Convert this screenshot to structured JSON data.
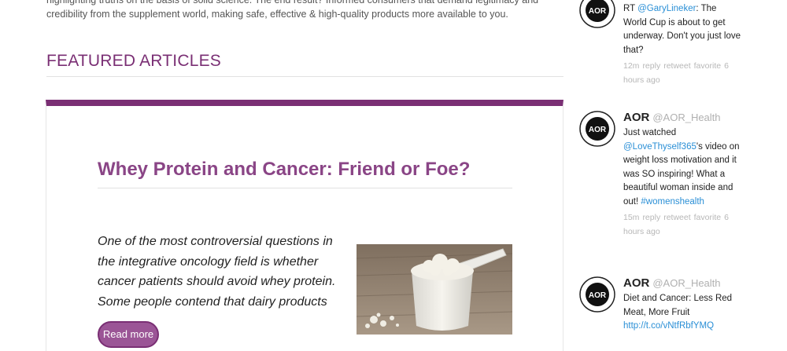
{
  "intro": {
    "line1": "highlighting truths on the basis of solid science. The end result? Informed consumers that demand legitimacy and",
    "line2": "credibility from the supplement world, making safe, effective & high-quality products more available to you."
  },
  "featured": {
    "title": "FEATURED ARTICLES",
    "article": {
      "title": "Whey Protein and Cancer: Friend or Foe?",
      "excerpt": "One of the most controversial questions in the integrative oncology field is whether cancer patients should avoid whey protein. Some people contend that dairy products",
      "read_more": "Read more",
      "image_alt": "scoop of whey protein powder"
    }
  },
  "tweets": [
    {
      "name": "",
      "handle": "",
      "text_prefix": "RT ",
      "mention": "@GaryLineker",
      "text_suffix": ": The World Cup is about to get underway. Don't you just love that?",
      "time": "12m",
      "reply": "reply",
      "retweet": "retweet",
      "favorite": "favorite",
      "ago": "6 hours ago"
    },
    {
      "name": "AOR",
      "handle": "@AOR_Health",
      "text_prefix": "Just watched ",
      "mention": "@LoveThyself365",
      "text_suffix": "'s video on weight loss motivation and it was SO inspiring! What a beautiful woman inside and out!",
      "hashtag": "#womenshealth",
      "time": "15m",
      "reply": "reply",
      "retweet": "retweet",
      "favorite": "favorite",
      "ago": "6 hours ago"
    },
    {
      "name": "AOR",
      "handle": "@AOR_Health",
      "text_prefix": "Diet and Cancer: Less Red Meat, More Fruit ",
      "link": "http://t.co/vNtfRbfYMQ"
    }
  ],
  "colors": {
    "brand_purple": "#7a2f74",
    "link_blue": "#2a8fd6"
  }
}
